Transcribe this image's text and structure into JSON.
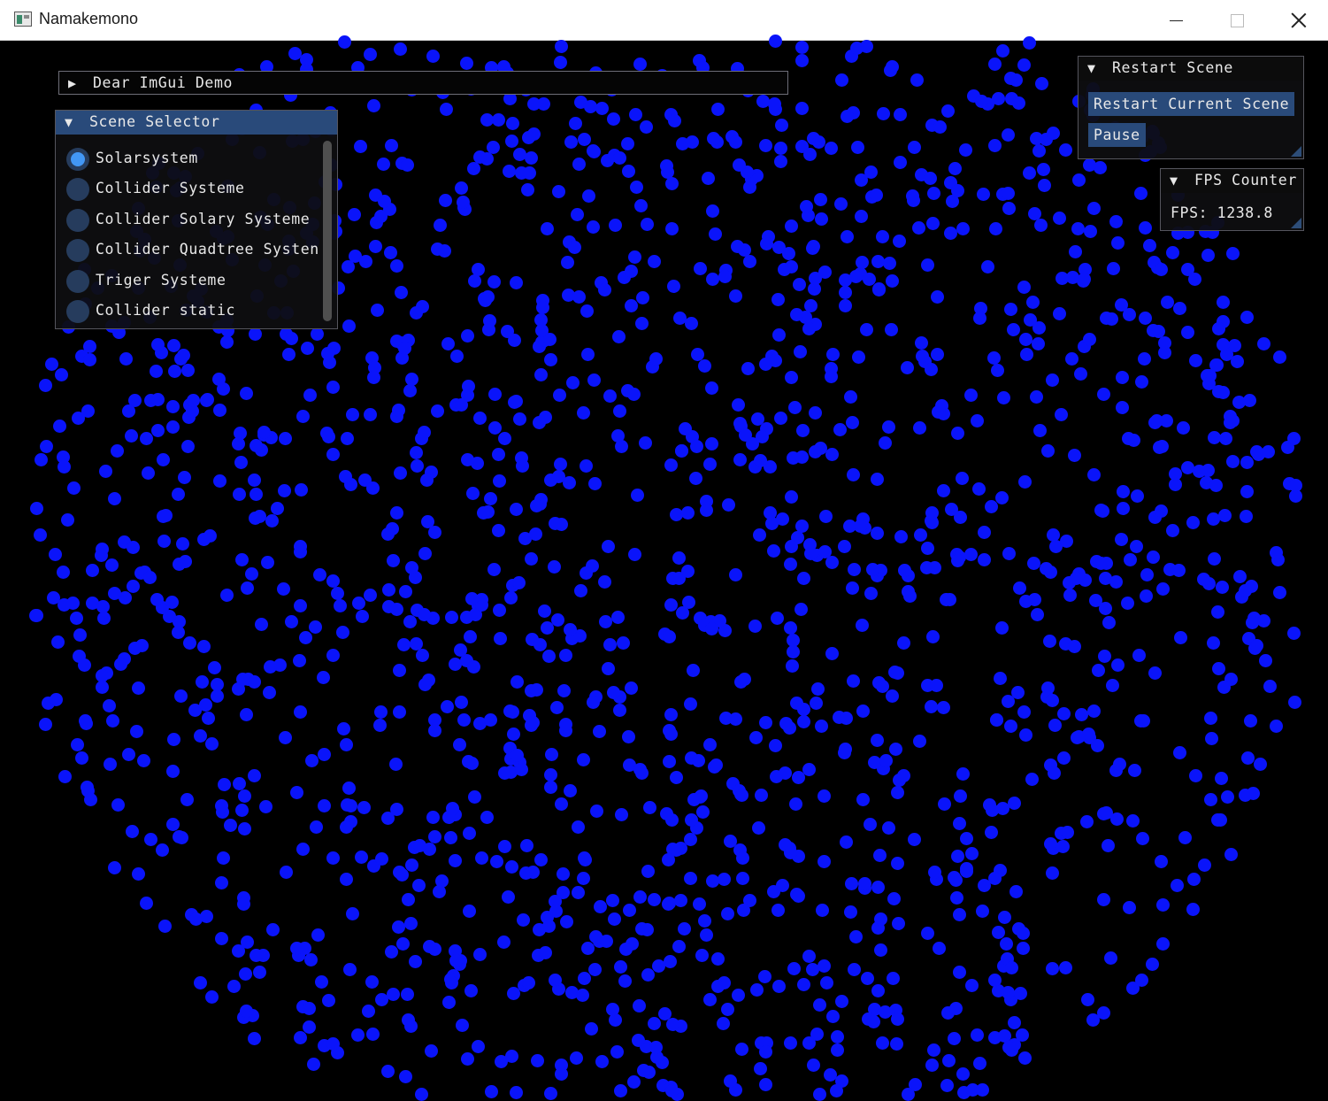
{
  "window": {
    "title": "Namakemono"
  },
  "demo_window": {
    "title": "Dear ImGui Demo"
  },
  "scene_selector": {
    "title": "Scene Selector",
    "selected_index": 0,
    "items": [
      {
        "label": "Solarsystem"
      },
      {
        "label": "Collider Systeme"
      },
      {
        "label": "Collider Solary Systeme"
      },
      {
        "label": "Collider Quadtree Systen"
      },
      {
        "label": "Triger Systeme"
      },
      {
        "label": "Collider static"
      }
    ]
  },
  "restart_panel": {
    "title": "Restart Scene",
    "restart_label": "Restart Current Scene",
    "pause_label": "Pause"
  },
  "fps_panel": {
    "title": "FPS Counter",
    "fps_text": "FPS: 1238.8"
  },
  "colors": {
    "particle": "#0a14fa",
    "imgui_header": "#294a7a",
    "radio_selected": "#4297f5",
    "background": "#000000"
  }
}
